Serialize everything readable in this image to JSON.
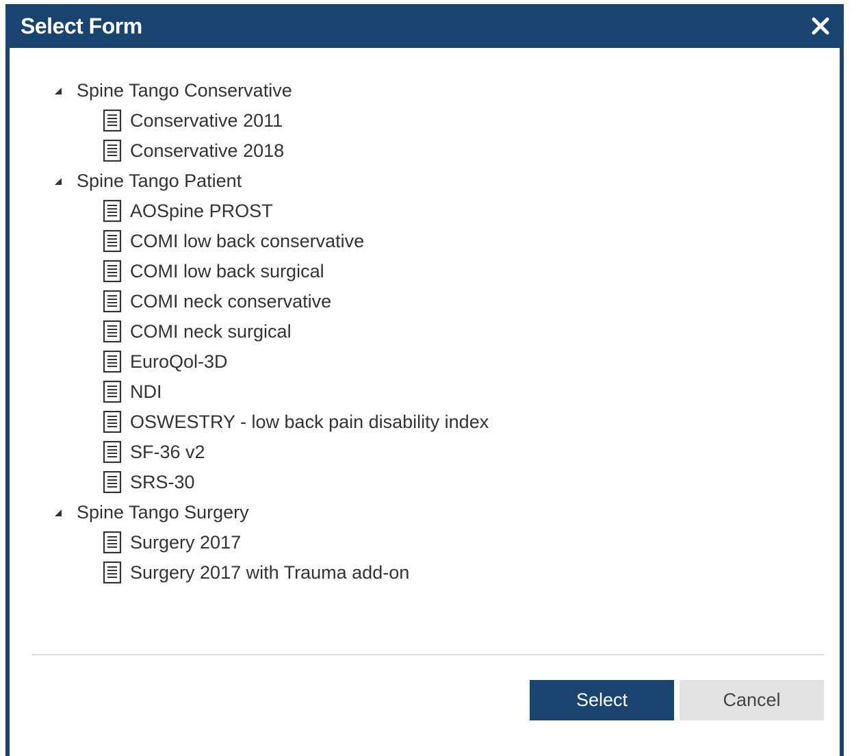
{
  "dialog": {
    "title": "Select Form",
    "close_icon": "close-icon"
  },
  "tree": {
    "groups": [
      {
        "label": "Spine Tango Conservative",
        "expanded": true,
        "items": [
          {
            "label": "Conservative 2011"
          },
          {
            "label": "Conservative 2018"
          }
        ]
      },
      {
        "label": "Spine Tango Patient",
        "expanded": true,
        "items": [
          {
            "label": "AOSpine PROST"
          },
          {
            "label": "COMI low back conservative"
          },
          {
            "label": "COMI low back surgical"
          },
          {
            "label": "COMI neck conservative"
          },
          {
            "label": "COMI neck surgical"
          },
          {
            "label": "EuroQol-3D"
          },
          {
            "label": "NDI"
          },
          {
            "label": "OSWESTRY - low back pain disability index"
          },
          {
            "label": "SF-36 v2"
          },
          {
            "label": "SRS-30"
          }
        ]
      },
      {
        "label": "Spine Tango Surgery",
        "expanded": true,
        "items": [
          {
            "label": "Surgery 2017"
          },
          {
            "label": "Surgery 2017 with Trauma add-on"
          }
        ]
      }
    ]
  },
  "footer": {
    "select_label": "Select",
    "cancel_label": "Cancel"
  },
  "colors": {
    "primary": "#1a4470",
    "secondary_button": "#e3e3e3",
    "text": "#333333"
  },
  "icons": {
    "expand": "caret-down-icon",
    "form": "document-icon"
  }
}
